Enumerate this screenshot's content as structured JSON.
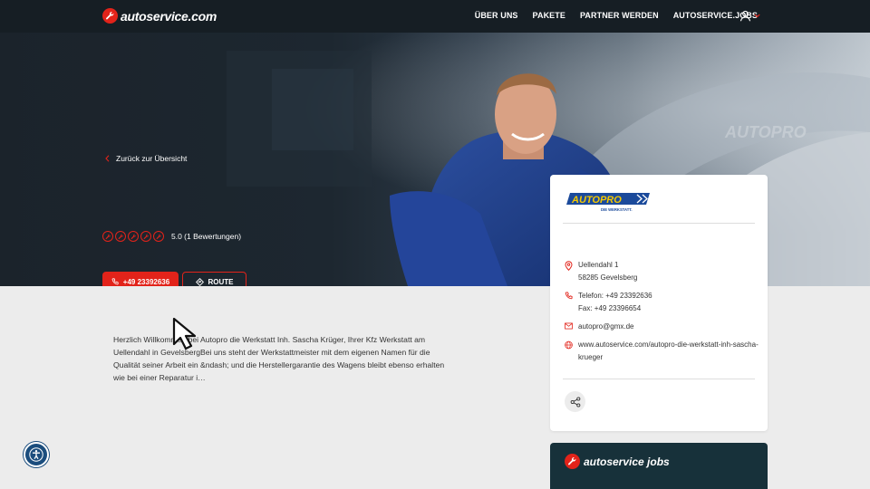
{
  "header": {
    "logo": "autoservice.com",
    "nav": [
      "ÜBER UNS",
      "PAKETE",
      "PARTNER WERDEN",
      "AUTOSERVICE.JOBS"
    ],
    "user_icon": "user-icon"
  },
  "hero": {
    "back_link": "Zurück zur Übersicht",
    "rating_icons": 5,
    "rating_text": "5.0 (1 Bewertungen)",
    "call_label": "+49 23392636",
    "route_label": "ROUTE",
    "background_watermark": "AUTOPRO"
  },
  "description": "Herzlich Willkommen bei Autopro die Werkstatt Inh. Sascha Krüger, Ihrer Kfz Werkstatt am Uellendahl in GevelsbergBei uns steht der Werkstattmeister mit dem eigenen Namen für die Qualität seiner Arbeit ein &ndash; und die Herstellergarantie des Wagens bleibt ebenso erhalten wie bei einer Reparatur i…",
  "card": {
    "logo_main": "AUTOPRO",
    "logo_sub": "DIE WERKSTATT.",
    "street": "Uellendahl 1",
    "city": "58285 Gevelsberg",
    "phone": "Telefon: +49 23392636",
    "fax": "Fax: +49 23396654",
    "email": "autopro@gmx.de",
    "website_line1": "www.autoservice.com/autopro-die-werkstatt-inh-sascha-",
    "website_line2": "krueger"
  },
  "jobs": {
    "logo": "autoservice jobs"
  },
  "colors": {
    "accent": "#e2231a",
    "header_bg": "#161e24",
    "jobs_bg": "#17313a",
    "page_bg": "#ececec"
  }
}
